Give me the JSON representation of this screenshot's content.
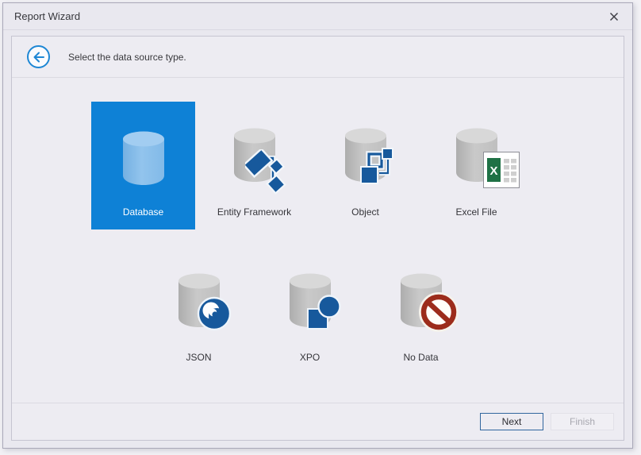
{
  "window": {
    "title": "Report Wizard",
    "icons": {
      "close": "close-x",
      "back": "back-arrow-circle"
    }
  },
  "wizard": {
    "prompt": "Select the data source type.",
    "sources": [
      {
        "label": "Database",
        "selected": true
      },
      {
        "label": "Entity Framework",
        "selected": false
      },
      {
        "label": "Object",
        "selected": false
      },
      {
        "label": "Excel File",
        "selected": false
      },
      {
        "label": "JSON",
        "selected": false
      },
      {
        "label": "XPO",
        "selected": false
      },
      {
        "label": "No Data",
        "selected": false
      }
    ],
    "footer": {
      "next_label": "Next",
      "finish_label": "Finish",
      "finish_enabled": false
    }
  },
  "colors": {
    "selected_tile_blue": "#0e81d6",
    "icon_blue": "#17599c",
    "nodata_red": "#9c2c1b",
    "excel_green": "#1f7145",
    "back_arrow_blue": "#1e87d4"
  }
}
